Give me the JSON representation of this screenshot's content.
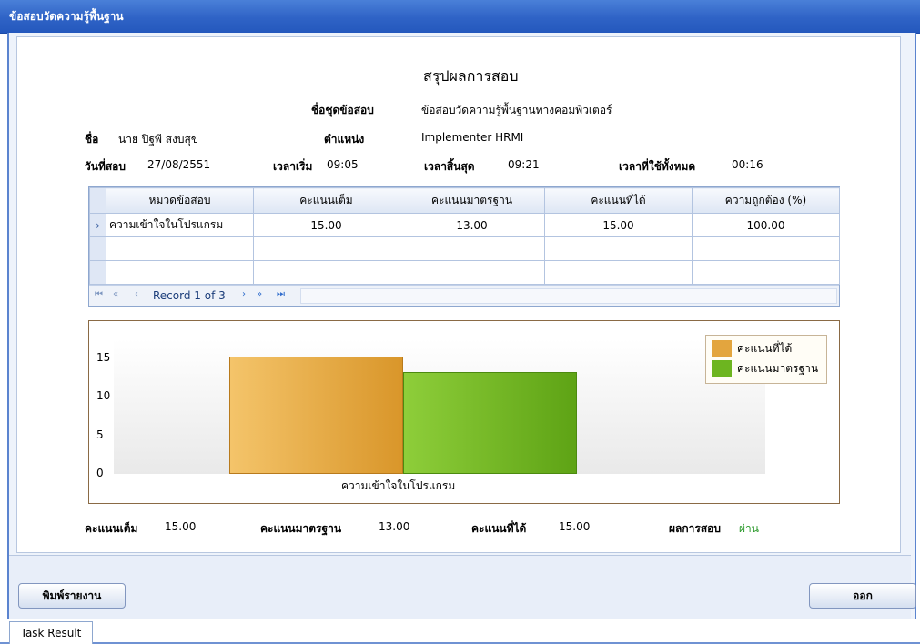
{
  "window": {
    "title": "ข้อสอบวัดความรู้พื้นฐาน"
  },
  "report": {
    "title": "สรุปผลการสอบ",
    "set_label": "ชื่อชุดข้อสอบ",
    "set_value": "ข้อสอบวัดความรู้พื้นฐานทางคอมพิวเตอร์",
    "name_label": "ชื่อ",
    "name_value": "นาย ปิฐพี สงบสุข",
    "position_label": "ตำแหน่ง",
    "position_value": "Implementer HRMI",
    "date_label": "วันที่สอบ",
    "date_value": "27/08/2551",
    "start_label": "เวลาเริ่ม",
    "start_value": "09:05",
    "end_label": "เวลาสิ้นสุด",
    "end_value": "09:21",
    "total_label": "เวลาที่ใช้ทั้งหมด",
    "total_value": "00:16"
  },
  "grid": {
    "columns": [
      "หมวดข้อสอบ",
      "คะแนนเต็ม",
      "คะแนนมาตรฐาน",
      "คะแนนที่ได้",
      "ความถูกต้อง (%)"
    ],
    "rows": [
      [
        "ความเข้าใจในโปรแกรม",
        "15.00",
        "13.00",
        "15.00",
        "100.00"
      ],
      [
        "",
        "",
        "",
        "",
        ""
      ],
      [
        "",
        "",
        "",
        "",
        ""
      ]
    ],
    "row_indicator": "›",
    "record_text": "Record 1 of 3",
    "nav_first": "⏮",
    "nav_prev_page": "«",
    "nav_prev": "‹",
    "nav_next": "›",
    "nav_next_page": "»",
    "nav_last": "⏭"
  },
  "chart_data": {
    "type": "bar",
    "categories": [
      "ความเข้าใจในโปรแกรม"
    ],
    "series": [
      {
        "name": "คะแนนที่ได้",
        "values": [
          15
        ],
        "color": "#e3a53e"
      },
      {
        "name": "คะแนนมาตรฐาน",
        "values": [
          13
        ],
        "color": "#6db520"
      }
    ],
    "yticks": [
      0,
      5,
      10,
      15
    ],
    "ylim": [
      0,
      17.5
    ],
    "legend": "top-right",
    "grid": false
  },
  "summary": {
    "full_label": "คะแนนเต็ม",
    "full_value": "15.00",
    "std_label": "คะแนนมาตรฐาน",
    "std_value": "13.00",
    "got_label": "คะแนนที่ได้",
    "got_value": "15.00",
    "result_label": "ผลการสอบ",
    "result_value": "ผ่าน",
    "result_color": "#2c9a2c"
  },
  "buttons": {
    "print": "พิมพ์รายงาน",
    "exit": "ออก"
  },
  "tabs": {
    "task_result": "Task Result"
  }
}
